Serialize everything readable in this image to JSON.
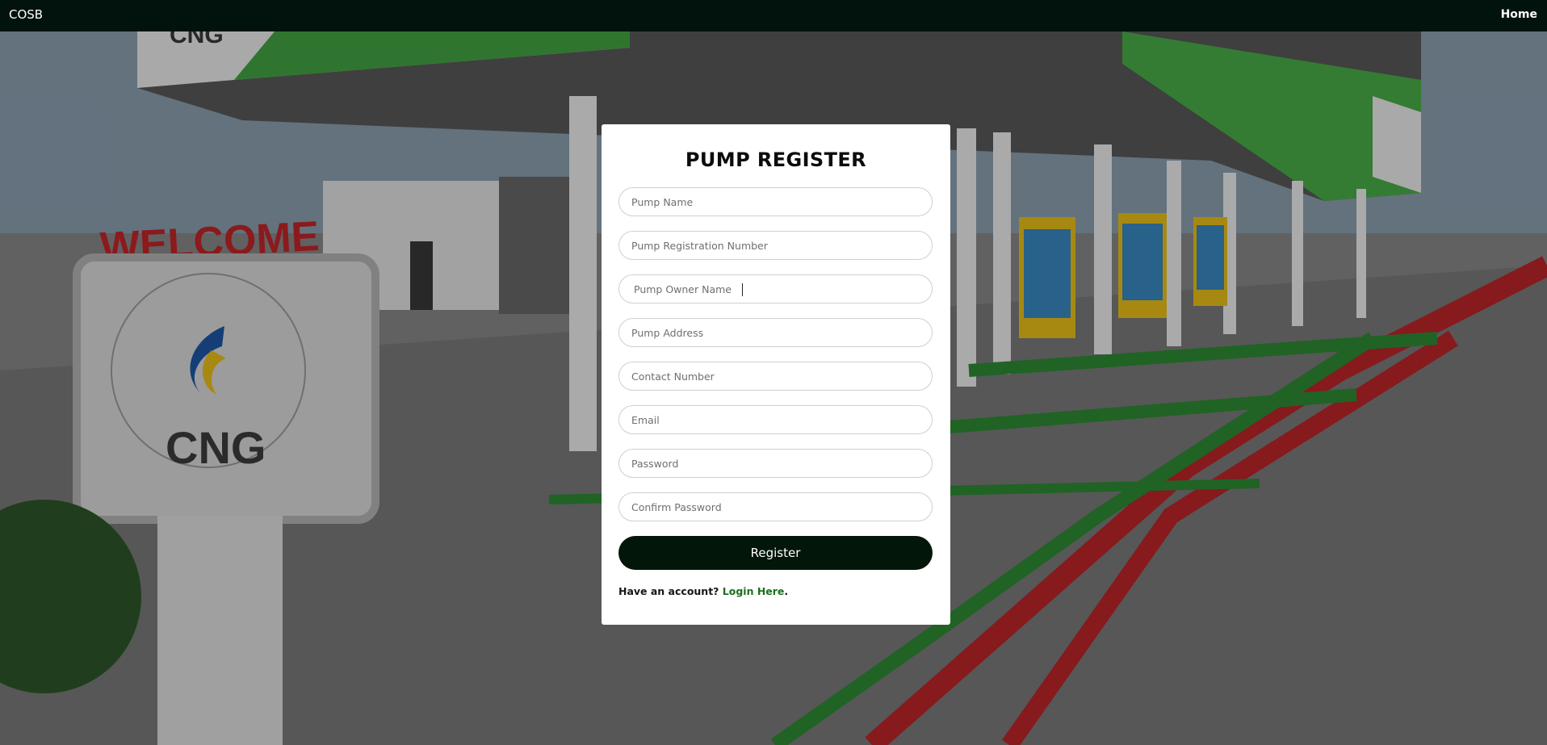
{
  "navbar": {
    "brand": "COSB",
    "home_label": "Home"
  },
  "background": {
    "sign_welcome": "WELCOME",
    "sign_cng": "CNG",
    "canopy_cng": "CNG"
  },
  "form": {
    "title": "PUMP REGISTER",
    "fields": [
      {
        "placeholder": "Pump Name",
        "value": ""
      },
      {
        "placeholder": "Pump Registration Number",
        "value": ""
      },
      {
        "placeholder": "Pump Owner Name",
        "value": ""
      },
      {
        "placeholder": "Pump Address",
        "value": ""
      },
      {
        "placeholder": "Contact Number",
        "value": ""
      },
      {
        "placeholder": "Email",
        "value": ""
      },
      {
        "placeholder": "Password",
        "value": ""
      },
      {
        "placeholder": "Confirm Password",
        "value": ""
      }
    ],
    "focused_field": "Pump Owner Name",
    "register_label": "Register",
    "have_account_text": "Have an account?",
    "login_link": "Login Here",
    "login_suffix": "."
  },
  "colors": {
    "navbar_bg": "#02120c",
    "button_bg": "#02160a",
    "link": "#1b6e1f",
    "canopy_green": "#3aa83c",
    "lane_red": "#c0262a",
    "lane_green": "#2e8e35"
  }
}
